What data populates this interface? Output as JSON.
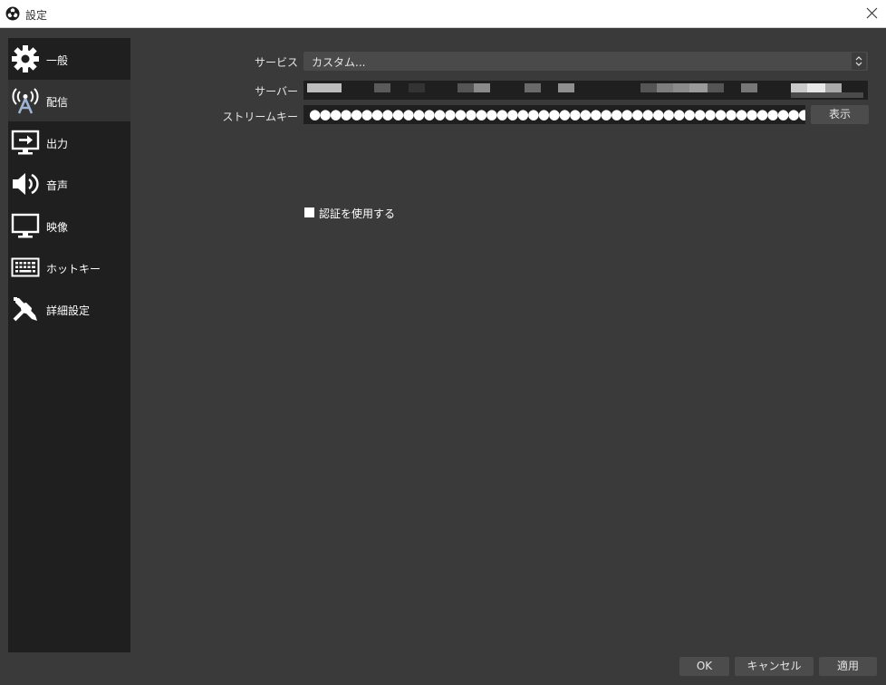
{
  "window": {
    "title": "設定",
    "app_icon": "obs-logo-icon",
    "close_icon": "close-icon"
  },
  "sidebar": {
    "items": [
      {
        "label": "一般",
        "icon": "gear-icon",
        "active": false
      },
      {
        "label": "配信",
        "icon": "antenna-icon",
        "active": true
      },
      {
        "label": "出力",
        "icon": "output-icon",
        "active": false
      },
      {
        "label": "音声",
        "icon": "speaker-icon",
        "active": false
      },
      {
        "label": "映像",
        "icon": "monitor-icon",
        "active": false
      },
      {
        "label": "ホットキー",
        "icon": "keyboard-icon",
        "active": false
      },
      {
        "label": "詳細設定",
        "icon": "tools-icon",
        "active": false
      }
    ]
  },
  "stream": {
    "service_label": "サービス",
    "service_value": "カスタム...",
    "server_label": "サーバー",
    "key_label": "ストリームキー",
    "key_value": "●●●●●●●●●●●●●●●●●●●●●●●●●●●●●●●●●●●●●●●●●●●●●●●●●●●",
    "show_button": "表示",
    "auth_checkbox_label": "認証を使用する",
    "auth_checked": false
  },
  "footer": {
    "ok": "OK",
    "cancel": "キャンセル",
    "apply": "適用"
  },
  "colors": {
    "background": "#3a3a3a",
    "sidebar": "#1f1f1f",
    "sidebar_active": "#333333",
    "input_dark": "#1f1f1f",
    "button": "#4c4c4c"
  }
}
